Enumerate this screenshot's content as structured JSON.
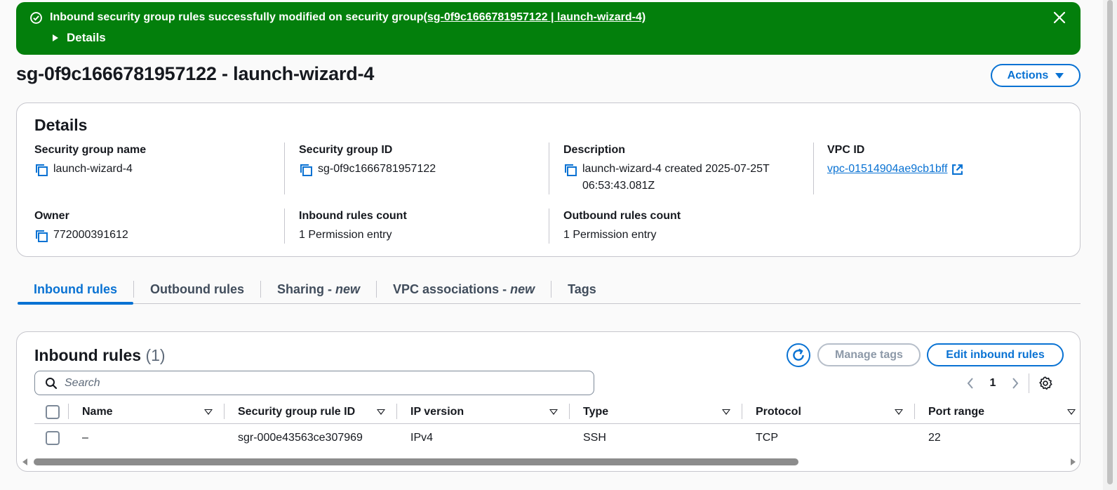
{
  "flash": {
    "message": "Inbound security group rules successfully modified on security group ",
    "link_text": "(sg-0f9c1666781957122 | launch-wizard-4)",
    "details_label": "Details"
  },
  "page": {
    "title": "sg-0f9c1666781957122 - launch-wizard-4",
    "actions_label": "Actions"
  },
  "details": {
    "heading": "Details",
    "fields": {
      "sg_name": {
        "label": "Security group name",
        "value": "launch-wizard-4"
      },
      "sg_id": {
        "label": "Security group ID",
        "value": "sg-0f9c1666781957122"
      },
      "description": {
        "label": "Description",
        "value": "launch-wizard-4 created 2025-07-25T 06:53:43.081Z"
      },
      "vpc_id": {
        "label": "VPC ID",
        "value": "vpc-01514904ae9cb1bff"
      },
      "owner": {
        "label": "Owner",
        "value": "772000391612"
      },
      "inbound_count": {
        "label": "Inbound rules count",
        "value": "1 Permission entry"
      },
      "outbound_count": {
        "label": "Outbound rules count",
        "value": "1 Permission entry"
      }
    }
  },
  "tabs": [
    {
      "label": "Inbound rules",
      "suffix": ""
    },
    {
      "label": "Outbound rules",
      "suffix": ""
    },
    {
      "label": "Sharing - ",
      "suffix": "new"
    },
    {
      "label": "VPC associations - ",
      "suffix": "new"
    },
    {
      "label": "Tags",
      "suffix": ""
    }
  ],
  "rules": {
    "heading": "Inbound rules",
    "count": "(1)",
    "manage_tags_label": "Manage tags",
    "edit_label": "Edit inbound rules",
    "search_placeholder": "Search",
    "page_number": "1",
    "columns": [
      "Name",
      "Security group rule ID",
      "IP version",
      "Type",
      "Protocol",
      "Port range"
    ],
    "rows": [
      {
        "name": "–",
        "rule_id": "sgr-000e43563ce307969",
        "ip_version": "IPv4",
        "type": "SSH",
        "protocol": "TCP",
        "port_range": "22"
      }
    ]
  },
  "colors": {
    "success": "#037f0c",
    "accent": "#0972d3",
    "border": "#c6c6cd"
  }
}
